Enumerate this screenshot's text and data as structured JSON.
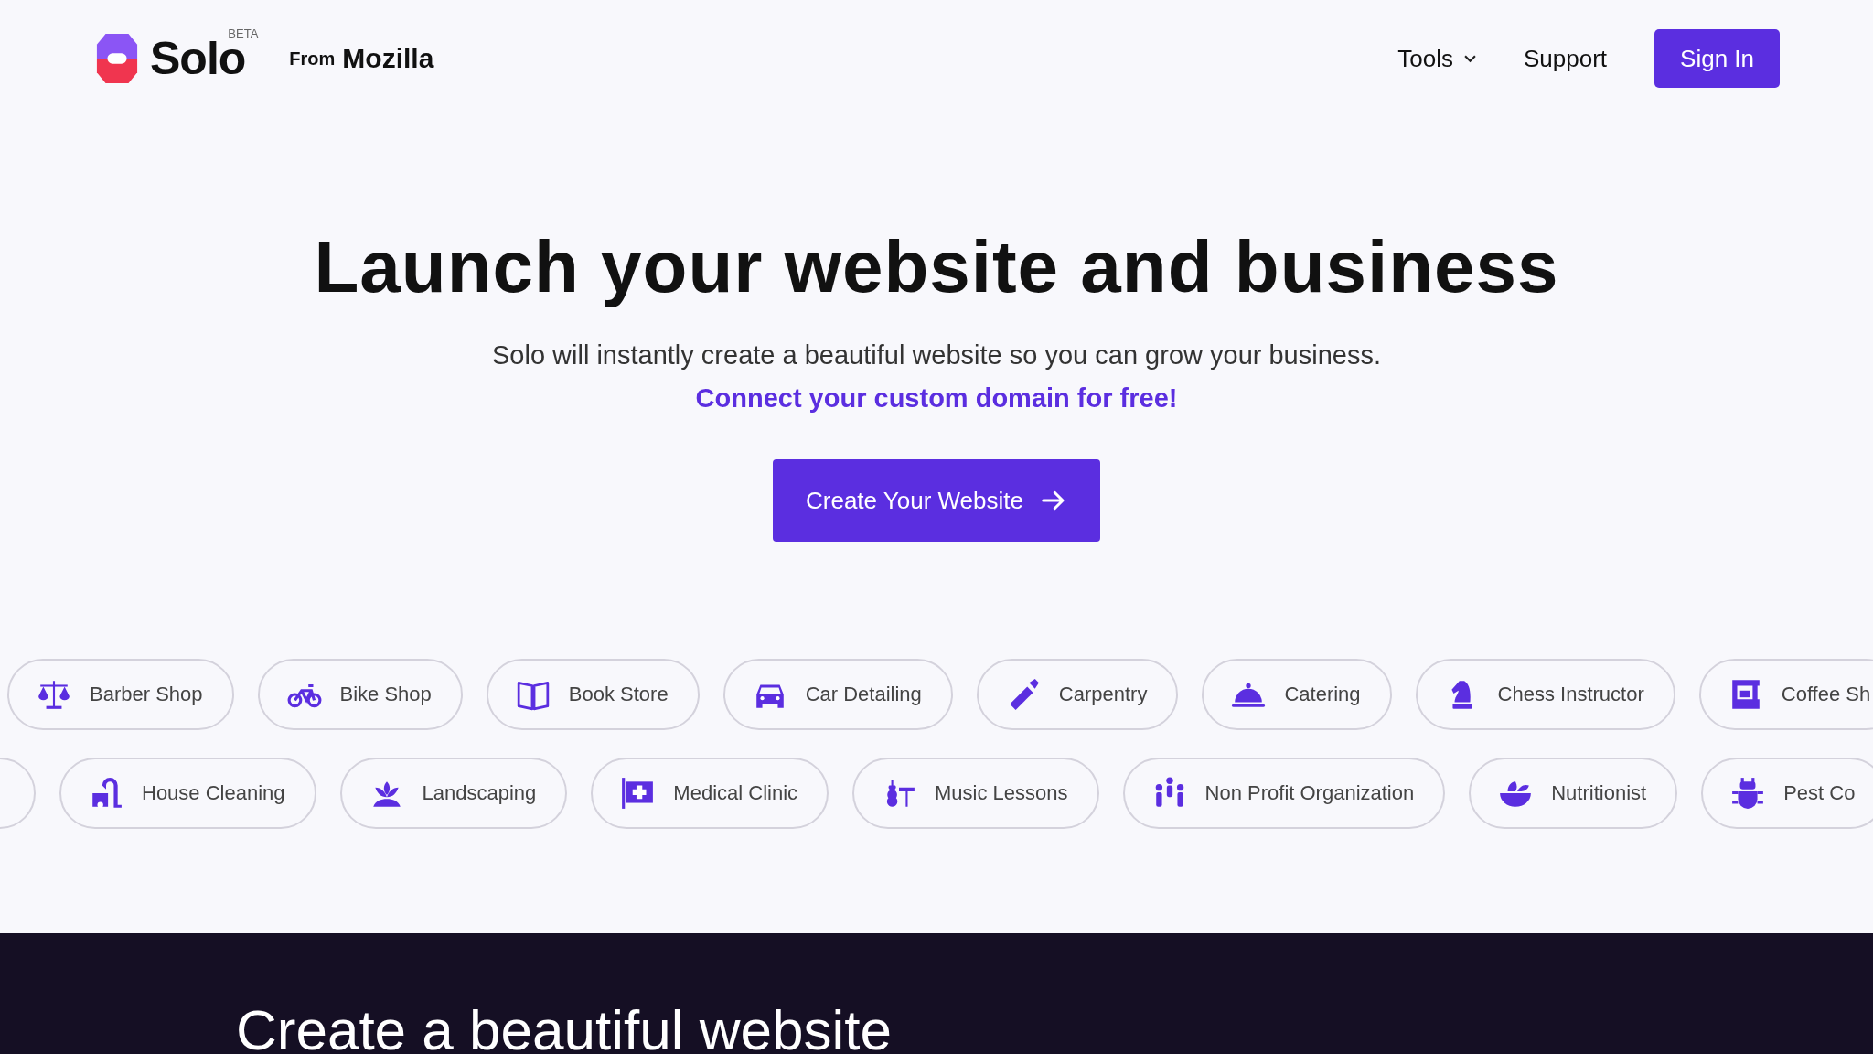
{
  "header": {
    "logo": {
      "name": "Solo",
      "badge": "BETA"
    },
    "from": {
      "prefix": "From",
      "brand": "Mozilla"
    },
    "nav": [
      {
        "label": "Tools",
        "dropdown": true
      },
      {
        "label": "Support",
        "dropdown": false
      }
    ],
    "sign_in": "Sign In"
  },
  "hero": {
    "title": "Launch your website and business",
    "subtitle": "Solo will instantly create a beautiful website so you can grow your business.",
    "link": "Connect your custom domain for free!",
    "cta": "Create Your Website"
  },
  "categories": [
    [
      {
        "label": "Barber Shop"
      },
      {
        "label": "Bike Shop"
      },
      {
        "label": "Book Store"
      },
      {
        "label": "Car Detailing"
      },
      {
        "label": "Carpentry"
      },
      {
        "label": "Catering"
      },
      {
        "label": "Chess Instructor"
      },
      {
        "label": "Coffee Sh"
      }
    ],
    [
      {
        "label": "House Cleaning"
      },
      {
        "label": "Landscaping"
      },
      {
        "label": "Medical Clinic"
      },
      {
        "label": "Music Lessons"
      },
      {
        "label": "Non Profit Organization"
      },
      {
        "label": "Nutritionist"
      },
      {
        "label": "Pest Co"
      }
    ]
  ],
  "section": {
    "title": "Create a beautiful website"
  }
}
